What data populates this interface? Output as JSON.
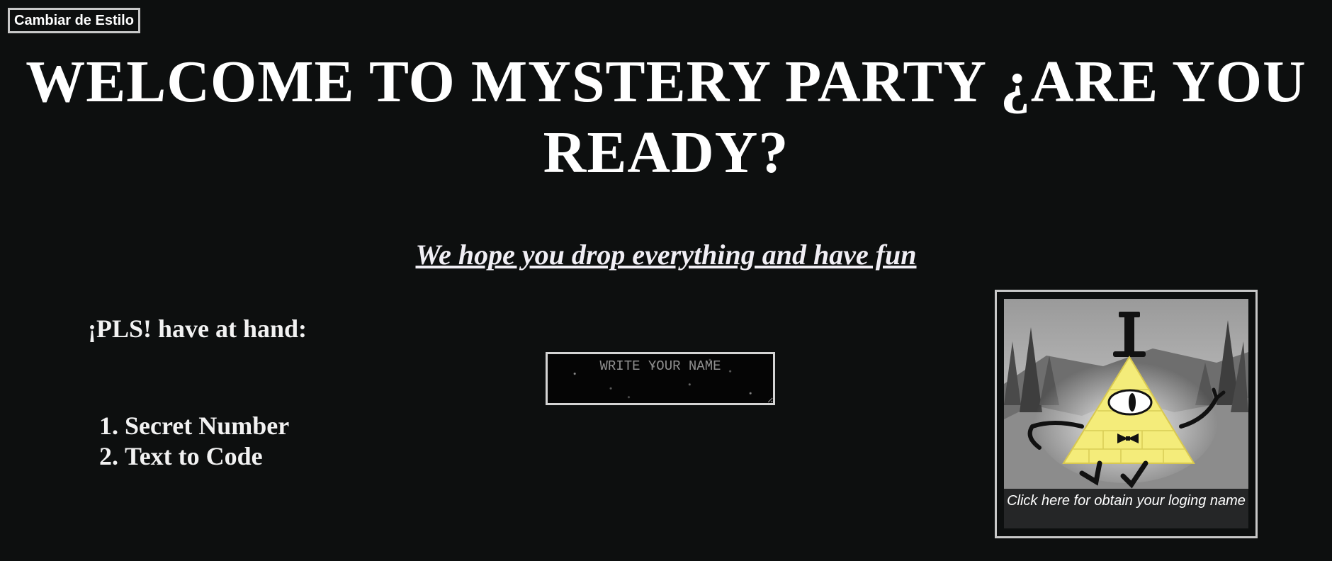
{
  "style_button": {
    "label": "Cambiar de Estilo"
  },
  "header": {
    "title": "WELCOME TO MYSTERY PARTY ¿ARE YOU READY?"
  },
  "tagline": {
    "text": "We hope you drop everything and have fun"
  },
  "checklist": {
    "heading": "¡PLS! have at hand:",
    "items": [
      "Secret Number",
      "Text to Code"
    ]
  },
  "name_input": {
    "placeholder": "WRITE YOUR NAME",
    "value": ""
  },
  "login_card": {
    "image_icon": "bill-cipher-triangle-icon",
    "caption": "Click here for obtain your loging name"
  },
  "colors": {
    "background": "#0d0f0f",
    "text": "#ffffff",
    "border": "#c8c8c8",
    "triangle": "#f4ec7a"
  }
}
